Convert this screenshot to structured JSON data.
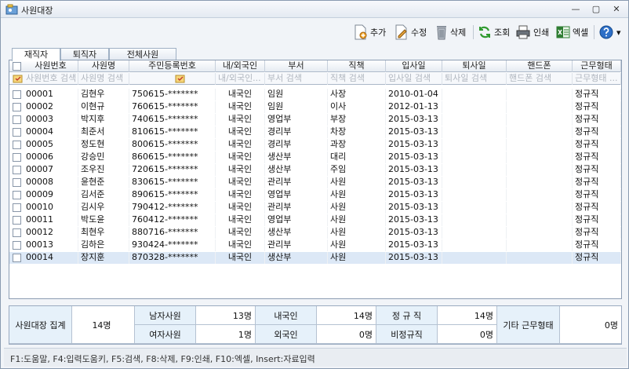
{
  "window": {
    "title": "사원대장",
    "minimize": "—",
    "restore": "▢",
    "close": "✕"
  },
  "toolbar": {
    "add": "추가",
    "edit": "수정",
    "delete": "삭제",
    "search": "조회",
    "print": "인쇄",
    "excel": "엑셀",
    "help_icon": "help-icon",
    "dropdown": "▾"
  },
  "tabs": [
    "재직자",
    "퇴직자",
    "전체사원"
  ],
  "columns": [
    {
      "key": "id",
      "label": "사원번호",
      "filter": "사원번호 검색"
    },
    {
      "key": "name",
      "label": "사원명",
      "filter": "사원명 검색"
    },
    {
      "key": "rrn",
      "label": "주민등록번호",
      "filter": ""
    },
    {
      "key": "nat",
      "label": "내/외국인",
      "filter": "내/외국인..."
    },
    {
      "key": "dept",
      "label": "부서",
      "filter": "부서 검색"
    },
    {
      "key": "pos",
      "label": "직책",
      "filter": "직책 검색"
    },
    {
      "key": "join",
      "label": "입사일",
      "filter": "입사일 검색"
    },
    {
      "key": "leave",
      "label": "퇴사일",
      "filter": "퇴사일 검색"
    },
    {
      "key": "phone",
      "label": "핸드폰",
      "filter": "핸드폰 검색"
    },
    {
      "key": "type",
      "label": "근무형태",
      "filter": "근무형태 ..."
    }
  ],
  "rows": [
    [
      "00001",
      "김현우",
      "750615-*******",
      "내국인",
      "임원",
      "사장",
      "2010-01-04",
      "",
      "",
      "정규직"
    ],
    [
      "00002",
      "이현규",
      "760615-*******",
      "내국인",
      "임원",
      "이사",
      "2012-01-13",
      "",
      "",
      "정규직"
    ],
    [
      "00003",
      "박지후",
      "740615-*******",
      "내국인",
      "영업부",
      "부장",
      "2015-03-13",
      "",
      "",
      "정규직"
    ],
    [
      "00004",
      "최준서",
      "810615-*******",
      "내국인",
      "경리부",
      "차장",
      "2015-03-13",
      "",
      "",
      "정규직"
    ],
    [
      "00005",
      "정도현",
      "800615-*******",
      "내국인",
      "경리부",
      "과장",
      "2015-03-13",
      "",
      "",
      "정규직"
    ],
    [
      "00006",
      "강승민",
      "860615-*******",
      "내국인",
      "생산부",
      "대리",
      "2015-03-13",
      "",
      "",
      "정규직"
    ],
    [
      "00007",
      "조우진",
      "720615-*******",
      "내국인",
      "생산부",
      "주임",
      "2015-03-13",
      "",
      "",
      "정규직"
    ],
    [
      "00008",
      "윤현준",
      "830615-*******",
      "내국인",
      "관리부",
      "사원",
      "2015-03-13",
      "",
      "",
      "정규직"
    ],
    [
      "00009",
      "김서준",
      "890615-*******",
      "내국인",
      "영업부",
      "사원",
      "2015-03-13",
      "",
      "",
      "정규직"
    ],
    [
      "00010",
      "김시우",
      "790412-*******",
      "내국인",
      "관리부",
      "사원",
      "2015-03-13",
      "",
      "",
      "정규직"
    ],
    [
      "00011",
      "박도윤",
      "760412-*******",
      "내국인",
      "영업부",
      "사원",
      "2015-03-13",
      "",
      "",
      "정규직"
    ],
    [
      "00012",
      "최현우",
      "880716-*******",
      "내국인",
      "생산부",
      "사원",
      "2015-03-13",
      "",
      "",
      "정규직"
    ],
    [
      "00013",
      "김하은",
      "930424-*******",
      "내국인",
      "관리부",
      "사원",
      "2015-03-13",
      "",
      "",
      "정규직"
    ],
    [
      "00014",
      "장지훈",
      "870328-*******",
      "내국인",
      "생산부",
      "사원",
      "2015-03-13",
      "",
      "",
      "정규직"
    ]
  ],
  "summary": {
    "title": "사원대장 집계",
    "total": "14명",
    "male_label": "남자사원",
    "male": "13명",
    "female_label": "여자사원",
    "female": "1명",
    "domestic_label": "내국인",
    "domestic": "14명",
    "foreign_label": "외국인",
    "foreign": "0명",
    "regular_label": "정 규 직",
    "regular": "14명",
    "irregular_label": "비정규직",
    "irregular": "0명",
    "other_label": "기타 근무형태",
    "other": "0명"
  },
  "status": "F1:도움말, F4:입력도움키, F5:검색, F8:삭제, F9:인쇄, F10:엑셀, Insert:자료입력",
  "colors": {
    "selected_row": "#dce8f6",
    "summary_label_bg": "#e6f1fa"
  }
}
